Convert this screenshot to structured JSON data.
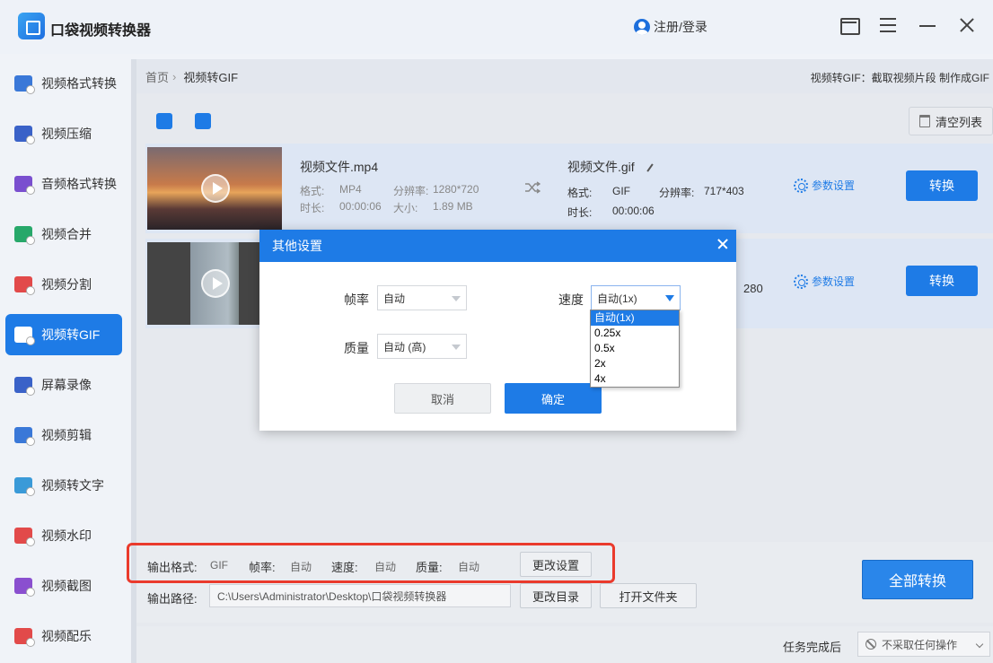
{
  "app": {
    "title": "口袋视频转换器",
    "login": "注册/登录"
  },
  "sidebar": {
    "items": [
      {
        "label": "视频格式转换",
        "color": "#3a78d8"
      },
      {
        "label": "视频压缩",
        "color": "#3a62c8"
      },
      {
        "label": "音频格式转换",
        "color": "#7a4fcf"
      },
      {
        "label": "视频合并",
        "color": "#27a86a"
      },
      {
        "label": "视频分割",
        "color": "#e24a4a"
      },
      {
        "label": "视频转GIF",
        "color": "#ffffff"
      },
      {
        "label": "屏幕录像",
        "color": "#3a62c8"
      },
      {
        "label": "视频剪辑",
        "color": "#3a78d8"
      },
      {
        "label": "视频转文字",
        "color": "#3a9ad8"
      },
      {
        "label": "视频水印",
        "color": "#e24a4a"
      },
      {
        "label": "视频截图",
        "color": "#8a4fcf"
      },
      {
        "label": "视频配乐",
        "color": "#e24a4a"
      }
    ]
  },
  "breadcrumb": {
    "home": "首页",
    "current": "视频转GIF",
    "description": "视频转GIF：截取视频片段 制作成GIF"
  },
  "toolbar": {
    "clear_label": "清空列表"
  },
  "files": [
    {
      "source_name": "视频文件.mp4",
      "format_label": "格式:",
      "format": "MP4",
      "resolution_label": "分辨率:",
      "resolution": "1280*720",
      "duration_label": "时长:",
      "duration": "00:00:06",
      "size_label": "大小:",
      "size": "1.89 MB",
      "output_name": "视频文件.gif",
      "out_format_label": "格式:",
      "out_format": "GIF",
      "out_resolution_label": "分辨率:",
      "out_resolution": "717*403",
      "out_duration_label": "时长:",
      "out_duration": "00:00:06",
      "params_label": "参数设置",
      "convert_label": "转换"
    },
    {
      "resolution_fragment": "280",
      "params_label": "参数设置",
      "convert_label": "转换"
    }
  ],
  "output": {
    "format_label": "输出格式:",
    "format": "GIF",
    "framerate_label": "帧率:",
    "framerate": "自动",
    "speed_label": "速度:",
    "speed": "自动",
    "quality_label": "质量:",
    "quality": "自动",
    "change_settings": "更改设置",
    "path_label": "输出路径:",
    "path": "C:\\Users\\Administrator\\Desktop\\口袋视频转换器",
    "change_dir": "更改目录",
    "open_folder": "打开文件夹",
    "convert_all": "全部转换"
  },
  "footer": {
    "after_label": "任务完成后",
    "after_value": "不采取任何操作"
  },
  "dialog": {
    "title": "其他设置",
    "framerate_label": "帧率",
    "framerate_value": "自动",
    "speed_label": "速度",
    "speed_value": "自动(1x)",
    "quality_label": "质量",
    "quality_value": "自动 (高)",
    "cancel": "取消",
    "ok": "确定",
    "speed_options": [
      "自动(1x)",
      "0.25x",
      "0.5x",
      "2x",
      "4x"
    ],
    "speed_selected_index": 0
  },
  "colors": {
    "accent": "#1e7be6",
    "highlight_frame": "#ea3a2c"
  }
}
